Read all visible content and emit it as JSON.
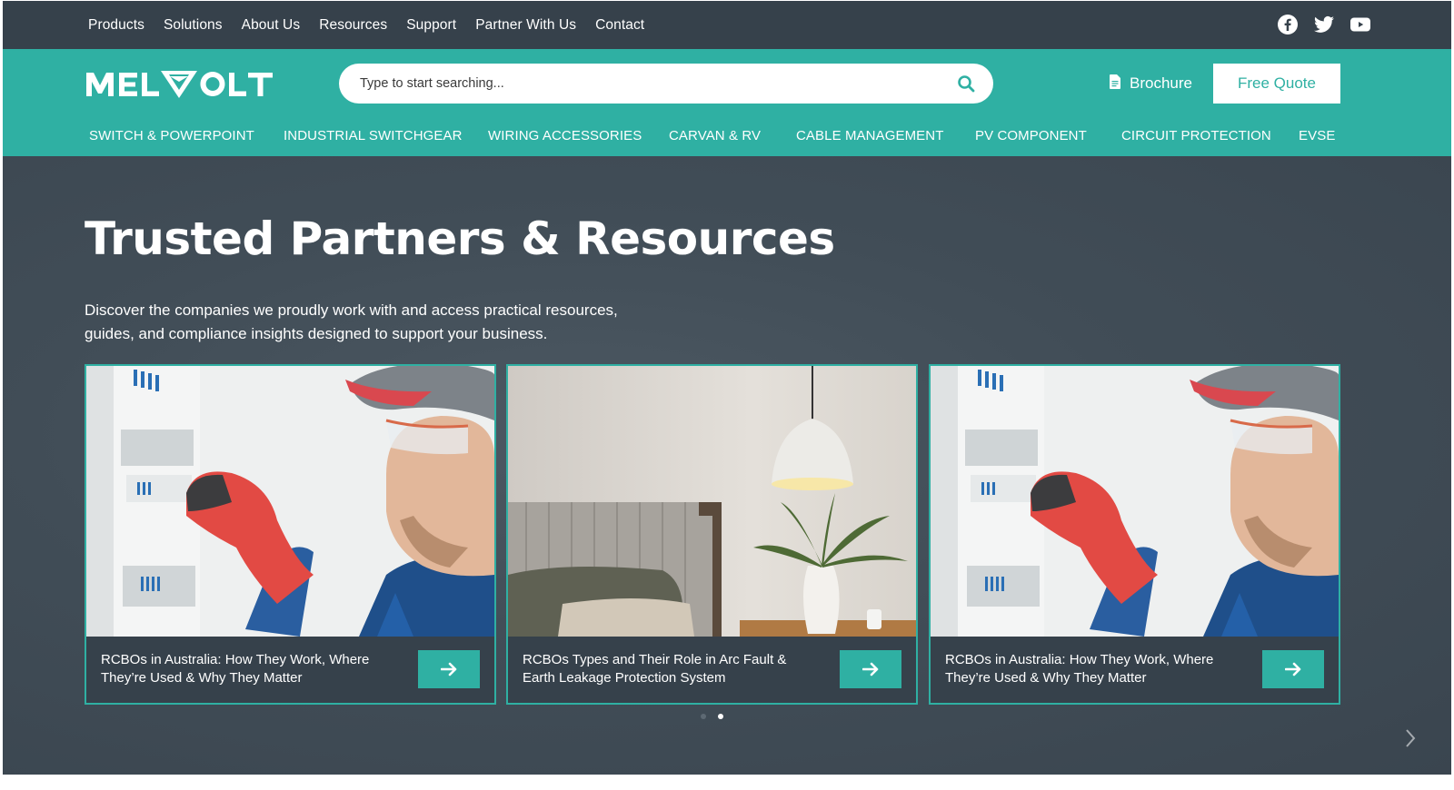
{
  "topnav": {
    "items": [
      "Products",
      "Solutions",
      "About Us",
      "Resources",
      "Support",
      "Partner With Us",
      "Contact"
    ]
  },
  "social": [
    "facebook-icon",
    "twitter-icon",
    "youtube-icon"
  ],
  "header": {
    "logo": "MELVOLT",
    "search_placeholder": "Type to start searching...",
    "brochure_label": "Brochure",
    "quote_label": "Free Quote"
  },
  "categories": [
    "SWITCH & POWERPOINT",
    "INDUSTRIAL SWITCHGEAR",
    "WIRING ACCESSORIES",
    "CARVAN & RV",
    "CABLE MANAGEMENT",
    "PV COMPONENT",
    "CIRCUIT PROTECTION",
    "EVSE"
  ],
  "hero": {
    "title": "Trusted Partners & Resources",
    "line1": "Discover the companies we proudly work with and access practical resources,",
    "line2": "guides, and compliance insights designed to support your business."
  },
  "cards": [
    {
      "title": "RCBOs in Australia: How They Work, Where They’re Used & Why They Matter",
      "image": "electrician-photo"
    },
    {
      "title": "RCBOs Types and Their Role in Arc Fault & Earth Leakage Protection System",
      "image": "bedroom-lamp-photo"
    },
    {
      "title": "RCBOs in Australia: How They Work, Where They’re Used & Why They Matter",
      "image": "electrician-photo"
    }
  ],
  "carousel": {
    "slides": 2,
    "active_index": 1
  },
  "colors": {
    "teal": "#2fb0a3",
    "dark": "#36414b",
    "hero_bg": "#414d57"
  }
}
